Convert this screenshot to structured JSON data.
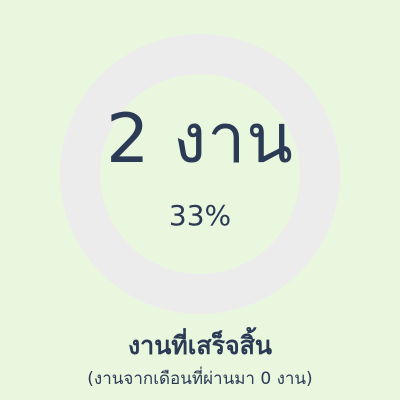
{
  "completion": {
    "value_text": "2 งาน",
    "percent_text": "33%",
    "fraction": 0.33,
    "label": "งานที่เสร็จสิ้น",
    "sublabel": "(งานจากเดือนที่ผ่านมา 0 งาน)"
  },
  "colors": {
    "background": "#eaf7df",
    "progress": "#77ee8f",
    "track": "#ececec",
    "text": "#2b3a55"
  }
}
